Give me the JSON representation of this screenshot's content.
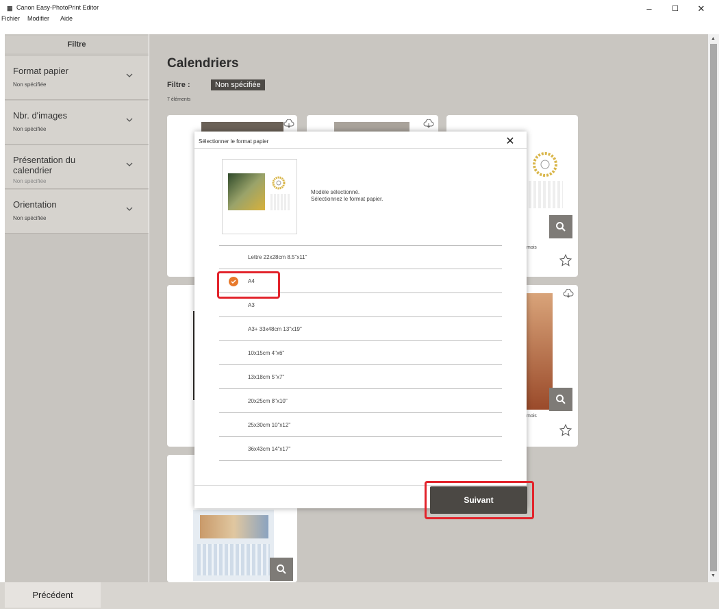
{
  "window": {
    "title": "Canon Easy-PhotoPrint Editor",
    "minimize": "–",
    "maximize": "☐",
    "close": "✕"
  },
  "menu": [
    "Fichier",
    "Modifier",
    "Aide"
  ],
  "sidebar": {
    "header": "Filtre",
    "items": [
      {
        "label": "Format papier",
        "value": "Non spécifiée"
      },
      {
        "label": "Nbr. d'images",
        "value": "Non spécifiée"
      },
      {
        "label": "Présentation du calendrier",
        "value": "Non spécifiée"
      },
      {
        "label": "Orientation",
        "value": "Non spécifiée"
      }
    ]
  },
  "main": {
    "title": "Calendriers",
    "filter_label": "Filtre :",
    "filter_value": "Non spécifiée",
    "count": "7 éléments",
    "card_caption": "mois"
  },
  "dialog": {
    "title": "Sélectionner le format papier",
    "close": "✕",
    "message_line1": "Modèle sélectionné.",
    "message_line2": "Sélectionnez le format papier.",
    "options": [
      {
        "label": "Lettre 22x28cm 8.5\"x11\"",
        "selected": false
      },
      {
        "label": "A4",
        "selected": true
      },
      {
        "label": "A3",
        "selected": false
      },
      {
        "label": "A3+ 33x48cm 13\"x19\"",
        "selected": false
      },
      {
        "label": "10x15cm 4\"x6\"",
        "selected": false
      },
      {
        "label": "13x18cm 5\"x7\"",
        "selected": false
      },
      {
        "label": "20x25cm 8\"x10\"",
        "selected": false
      },
      {
        "label": "25x30cm 10\"x12\"",
        "selected": false
      },
      {
        "label": "36x43cm 14\"x17\"",
        "selected": false
      }
    ],
    "next_label": "Suivant"
  },
  "footer": {
    "back_label": "Précédent"
  },
  "colors": {
    "accent_check": "#e8792c",
    "highlight": "#e2232b",
    "dark_button": "#4b4844"
  }
}
